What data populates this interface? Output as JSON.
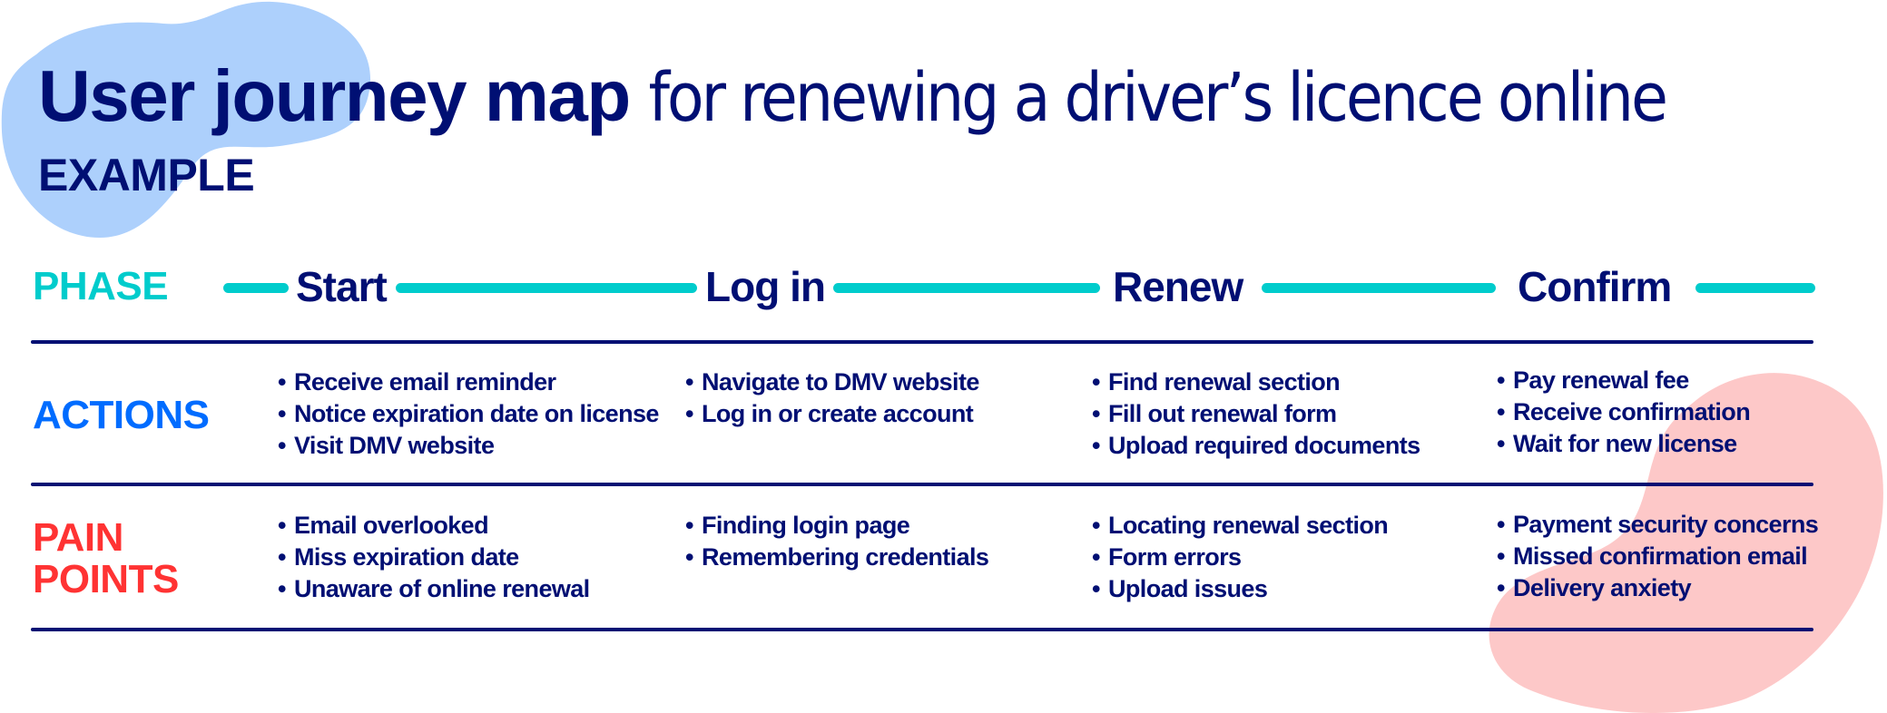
{
  "title": {
    "bold": "User journey map",
    "light": "for renewing a driver’s licence online",
    "subtitle": "EXAMPLE"
  },
  "colors": {
    "navy": "#000F73",
    "phase_teal": "#00CCCC",
    "actions_blue": "#006CFF",
    "pain_red": "#FF3333",
    "blob_blue": "#ADD0FC",
    "blob_pink": "#FDC8C8"
  },
  "rows": {
    "phase_label": "PHASE",
    "actions_label": "ACTIONS",
    "pain_label_line1": "PAIN",
    "pain_label_line2": "POINTS"
  },
  "phases": [
    {
      "name": "Start",
      "actions": [
        "Receive email reminder",
        "Notice expiration date on license",
        "Visit DMV website"
      ],
      "pain_points": [
        "Email overlooked",
        "Miss expiration date",
        "Unaware of online renewal"
      ]
    },
    {
      "name": "Log in",
      "actions": [
        "Navigate to DMV website",
        "Log in or create account"
      ],
      "pain_points": [
        "Finding login page",
        "Remembering credentials"
      ]
    },
    {
      "name": "Renew",
      "actions": [
        "Find renewal section",
        "Fill out renewal form",
        "Upload required documents"
      ],
      "pain_points": [
        "Locating renewal section",
        "Form errors",
        "Upload issues"
      ]
    },
    {
      "name": "Confirm",
      "actions": [
        "Pay renewal fee",
        "Receive confirmation",
        "Wait for new license"
      ],
      "pain_points": [
        "Payment security concerns",
        "Missed confirmation email",
        "Delivery anxiety"
      ]
    }
  ]
}
